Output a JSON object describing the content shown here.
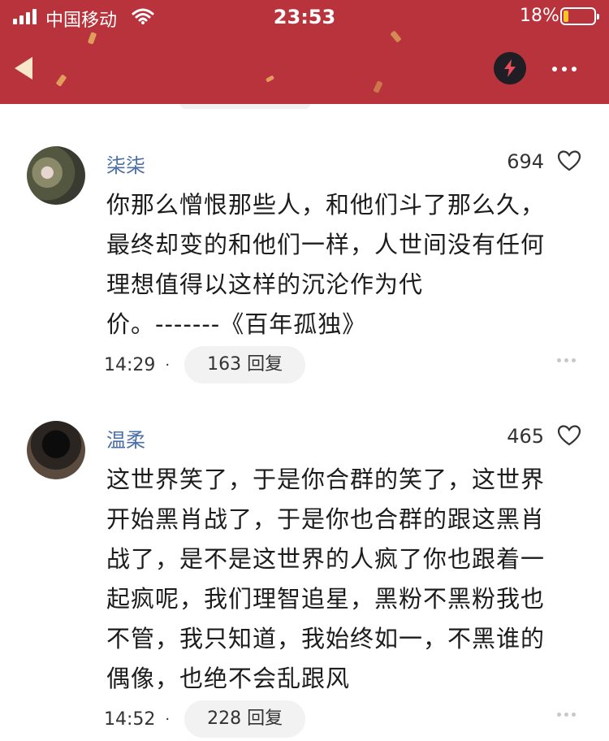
{
  "status_bar": {
    "carrier": "中国移动",
    "time": "23:53",
    "battery_percent": "18%",
    "battery_level": 0.18
  },
  "header": {
    "background_color": "#b8333c",
    "icons": [
      "back-icon",
      "lightning-icon",
      "more-icon"
    ]
  },
  "comments": [
    {
      "username": "柒柒",
      "likes": "694",
      "text_lines": [
        "你那么憎恨那些人，和他们斗了那么久，",
        "最终却变的和他们一样，人世间没有任何",
        "理想值得以这样的沉沦作为代",
        "价。-------《百年孤独》"
      ],
      "time": "14:29",
      "dot": "·",
      "reply_label": "163 回复"
    },
    {
      "username": "温柔",
      "likes": "465",
      "text_lines": [
        "这世界笑了，于是你合群的笑了，这世界",
        "开始黑肖战了，于是你也合群的跟这黑肖",
        "战了，是不是这世界的人疯了你也跟着一",
        "起疯呢，我们理智追星，黑粉不黑粉我也",
        "不管，我只知道，我始终如一，不黑谁的",
        "偶像，也绝不会乱跟风"
      ],
      "time": "14:52",
      "dot": "·",
      "reply_label": "228 回复"
    }
  ]
}
